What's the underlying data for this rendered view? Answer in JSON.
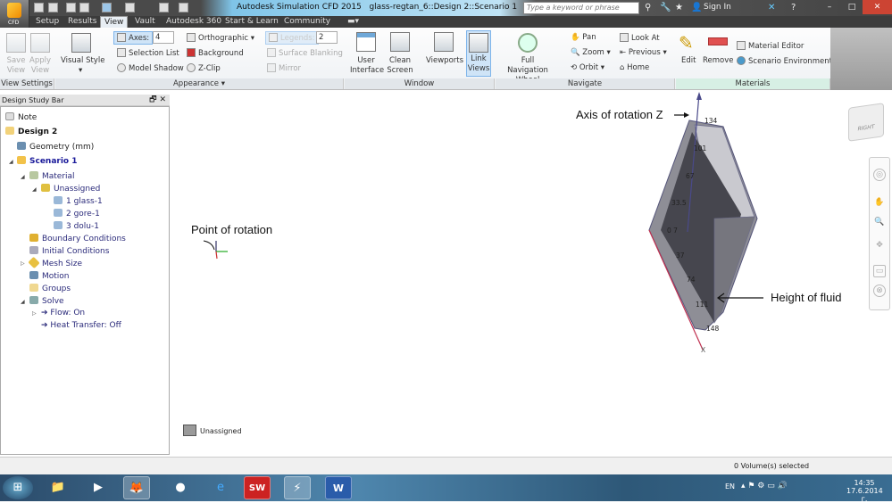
{
  "window": {
    "app_title": "Autodesk Simulation CFD 2015",
    "doc_title": "glass-regtan_6::Design 2::Scenario 1",
    "search_placeholder": "Type a keyword or phrase",
    "sign_in": "Sign In",
    "cfd_label": "CFD"
  },
  "tabs": [
    {
      "label": "Setup"
    },
    {
      "label": "Results"
    },
    {
      "label": "View",
      "active": true
    },
    {
      "label": "Vault"
    },
    {
      "label": "Autodesk 360"
    },
    {
      "label": "Start & Learn"
    },
    {
      "label": "Community"
    }
  ],
  "ribbon": {
    "view_settings": {
      "label": "View Settings",
      "save_view": "Save View",
      "apply_view": "Apply View"
    },
    "appearance": {
      "label": "Appearance",
      "visual_style": "Visual Style",
      "axes": "Axes:",
      "axes_value": "4",
      "selection_list": "Selection List",
      "model_shadow": "Model Shadow",
      "orthographic": "Orthographic",
      "background": "Background",
      "zclip": "Z-Clip",
      "legends": "Legends:",
      "legends_value": "2",
      "surface_blanking": "Surface Blanking",
      "mirror": "Mirror"
    },
    "window": {
      "label": "Window",
      "user_interface": "User Interface",
      "clean_screen": "Clean Screen",
      "viewports": "Viewports",
      "link_views": "Link Views"
    },
    "navigate": {
      "label": "Navigate",
      "full_nav_wheel": "Full Navigation Wheel",
      "pan": "Pan",
      "zoom": "Zoom",
      "orbit": "Orbit",
      "look_at": "Look At",
      "previous": "Previous",
      "home": "Home"
    },
    "materials": {
      "label": "Materials",
      "edit": "Edit",
      "remove": "Remove",
      "material_editor": "Material Editor",
      "scenario_environment": "Scenario Environment"
    }
  },
  "study_bar": {
    "title": "Design Study Bar",
    "items": [
      {
        "label": "Note"
      },
      {
        "label": "Design 2"
      },
      {
        "label": "Geometry (mm)"
      },
      {
        "label": "Scenario 1"
      },
      {
        "label": "Material"
      },
      {
        "label": "Unassigned"
      },
      {
        "label": "1 glass-1"
      },
      {
        "label": "2 gore-1"
      },
      {
        "label": "3 dolu-1"
      },
      {
        "label": "Boundary Conditions"
      },
      {
        "label": "Initial Conditions"
      },
      {
        "label": "Mesh Size"
      },
      {
        "label": "Motion"
      },
      {
        "label": "Groups"
      },
      {
        "label": "Solve"
      },
      {
        "label": "Flow: On"
      },
      {
        "label": "Heat Transfer: Off"
      }
    ]
  },
  "viewport": {
    "annotations": {
      "axis_rotation": "Axis of rotation Z",
      "point_rotation": "Point of rotation",
      "height_fluid": "Height of fluid"
    },
    "dimension_labels": [
      "134",
      "101",
      "67",
      "33.5",
      "0 7",
      "37",
      "74",
      "111",
      "148"
    ],
    "axis_label": "X",
    "viewcube_face": "RIGHT",
    "legend_label": "Unassigned"
  },
  "status": {
    "text": "0 Volume(s) selected"
  },
  "taskbar": {
    "language": "EN",
    "time": "14:35",
    "date": "17.6.2014 г."
  }
}
